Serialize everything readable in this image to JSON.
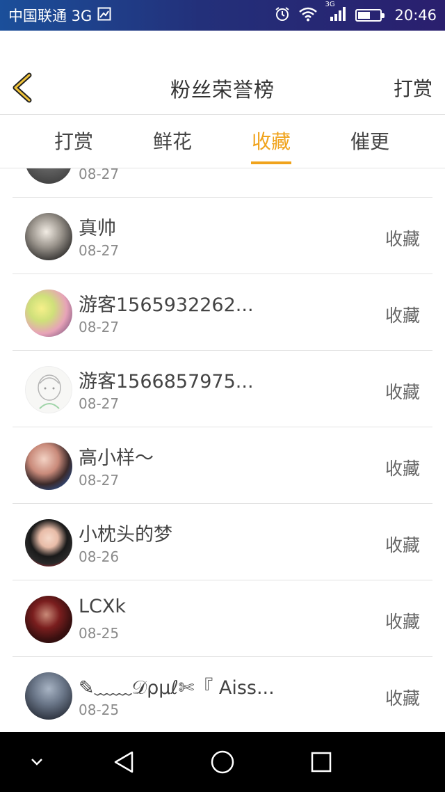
{
  "status_bar": {
    "carrier": "中国联通 3G",
    "network_badge": "3G",
    "time": "20:46",
    "icons": [
      "image-icon",
      "alarm-icon",
      "wifi-icon",
      "signal-icon",
      "battery-icon"
    ]
  },
  "header": {
    "title": "粉丝荣誉榜",
    "action_label": "打赏",
    "back_icon": "chevron-left-icon",
    "accent_color": "#f0a31c"
  },
  "tabs": [
    {
      "label": "打赏",
      "active": false
    },
    {
      "label": "鲜花",
      "active": false
    },
    {
      "label": "收藏",
      "active": true
    },
    {
      "label": "催更",
      "active": false
    }
  ],
  "list": {
    "partial_item": {
      "date": "08-27"
    },
    "items": [
      {
        "name": "真帅",
        "date": "08-27",
        "action": "收藏"
      },
      {
        "name": "游客1565932262...",
        "date": "08-27",
        "action": "收藏"
      },
      {
        "name": "游客1566857975...",
        "date": "08-27",
        "action": "收藏"
      },
      {
        "name": "高小样～",
        "date": "08-27",
        "action": "收藏"
      },
      {
        "name": "小枕头的梦",
        "date": "08-26",
        "action": "收藏"
      },
      {
        "name": "LCXk",
        "date": "08-25",
        "action": "收藏"
      },
      {
        "name": "✎﹏﹏𝒟ρμℓ✄『 Aiss...",
        "date": "08-25",
        "action": "收藏"
      }
    ]
  },
  "nav_bar": {
    "icons": [
      "chevron-down-icon",
      "back-triangle-icon",
      "home-circle-icon",
      "recents-square-icon"
    ]
  }
}
